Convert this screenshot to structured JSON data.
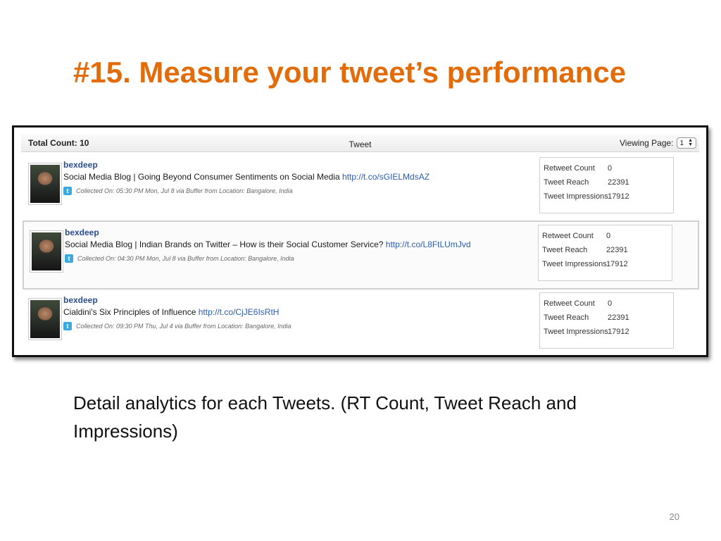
{
  "slide": {
    "title": "#15. Measure your tweet’s performance",
    "caption": "Detail analytics for each Tweets. (RT Count, Tweet Reach and Impressions)",
    "page_number": "20",
    "title_color": "#e36c0a"
  },
  "table": {
    "total_count": "Total Count: 10",
    "column_header": "Tweet",
    "viewing_page_label": "Viewing Page:",
    "page_select_value": "1",
    "tweets": [
      {
        "username": "bexdeep",
        "text": "Social Media Blog | Going Beyond Consumer Sentiments on Social Media",
        "link": "http://t.co/sGIELMdsAZ",
        "collected": "Collected On: 05:30 PM Mon, Jul 8 via Buffer from Location: Bangalore, India",
        "stats": {
          "retweet_label": "Retweet Count",
          "retweet_value": "0",
          "reach_label": "Tweet Reach",
          "reach_value": "22391",
          "impressions_label": "Tweet Impressions",
          "impressions_value": "17912"
        }
      },
      {
        "username": "bexdeep",
        "text": "Social Media Blog | Indian Brands on Twitter – How is their Social Customer Service?",
        "link": "http://t.co/L8FtLUmJvd",
        "collected": "Collected On: 04:30 PM Mon, Jul 8 via Buffer from Location: Bangalore, India",
        "stats": {
          "retweet_label": "Retweet Count",
          "retweet_value": "0",
          "reach_label": "Tweet Reach",
          "reach_value": "22391",
          "impressions_label": "Tweet Impressions",
          "impressions_value": "17912"
        }
      },
      {
        "username": "bexdeep",
        "text": "Cialdini's Six Principles of Influence",
        "link": "http://t.co/CjJE6IsRtH",
        "collected": "Collected On: 09:30 PM Thu, Jul 4 via Buffer from Location: Bangalore, India",
        "stats": {
          "retweet_label": "Retweet Count",
          "retweet_value": "0",
          "reach_label": "Tweet Reach",
          "reach_value": "22391",
          "impressions_label": "Tweet Impressions",
          "impressions_value": "17912"
        }
      }
    ]
  },
  "icons": {
    "twitter_glyph": "t",
    "select_arrows": "▲▼"
  }
}
